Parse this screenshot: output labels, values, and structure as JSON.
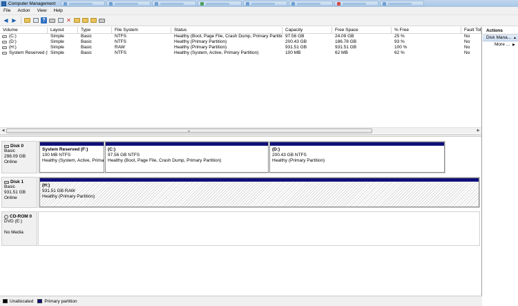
{
  "window": {
    "title": "Computer Management"
  },
  "menu": [
    "File",
    "Action",
    "View",
    "Help"
  ],
  "volume_table": {
    "columns": [
      "Volume",
      "Layout",
      "Type",
      "File System",
      "Status",
      "Capacity",
      "Free Space",
      "% Free",
      "Fault Tole"
    ],
    "rows": [
      [
        "(C:)",
        "Simple",
        "Basic",
        "NTFS",
        "Healthy (Boot, Page File, Crash Dump, Primary Partition)",
        "97.56 GB",
        "24.09 GB",
        "25 %",
        "No"
      ],
      [
        "(D:)",
        "Simple",
        "Basic",
        "NTFS",
        "Healthy (Primary Partition)",
        "200.43 GB",
        "186.78 GB",
        "93 %",
        "No"
      ],
      [
        "(H:)",
        "Simple",
        "Basic",
        "RAW",
        "Healthy (Primary Partition)",
        "931.51 GB",
        "931.51 GB",
        "100 %",
        "No"
      ],
      [
        "System Reserved (F:)",
        "Simple",
        "Basic",
        "NTFS",
        "Healthy (System, Active, Primary Partition)",
        "100 MB",
        "62 MB",
        "62 %",
        "No"
      ]
    ]
  },
  "scrollbar": {
    "grip": "III"
  },
  "disks": [
    {
      "name": "Disk 0",
      "type": "Basic",
      "size": "298.09 GB",
      "state": "Online",
      "partitions": [
        {
          "title": "System Reserved  (F:)",
          "size_fs": "100 MB NTFS",
          "status": "Healthy (System, Active, Primar"
        },
        {
          "title": "(C:)",
          "size_fs": "97.56 GB NTFS",
          "status": "Healthy (Boot, Page File, Crash Dump, Primary Partition)"
        },
        {
          "title": "(D:)",
          "size_fs": "200.43 GB NTFS",
          "status": "Healthy (Primary Partition)"
        }
      ]
    },
    {
      "name": "Disk 1",
      "type": "Basic",
      "size": "931.51 GB",
      "state": "Online",
      "partitions": [
        {
          "title": "(H:)",
          "size_fs": "931.51 GB RAW",
          "status": "Healthy (Primary Partition)"
        }
      ]
    },
    {
      "name": "CD-ROM 0",
      "type": "DVD (E:)",
      "state": "No Media"
    }
  ],
  "legend": [
    {
      "label": "Unallocated",
      "color": "#000000"
    },
    {
      "label": "Primary partition",
      "color": "#0f0f7a"
    }
  ],
  "actions": {
    "header": "Actions",
    "section": "Disk Mana...",
    "more": "More ..."
  },
  "colors": {
    "partition_bar": "#0f0f7a",
    "titlebar": "#bfd6ee"
  }
}
